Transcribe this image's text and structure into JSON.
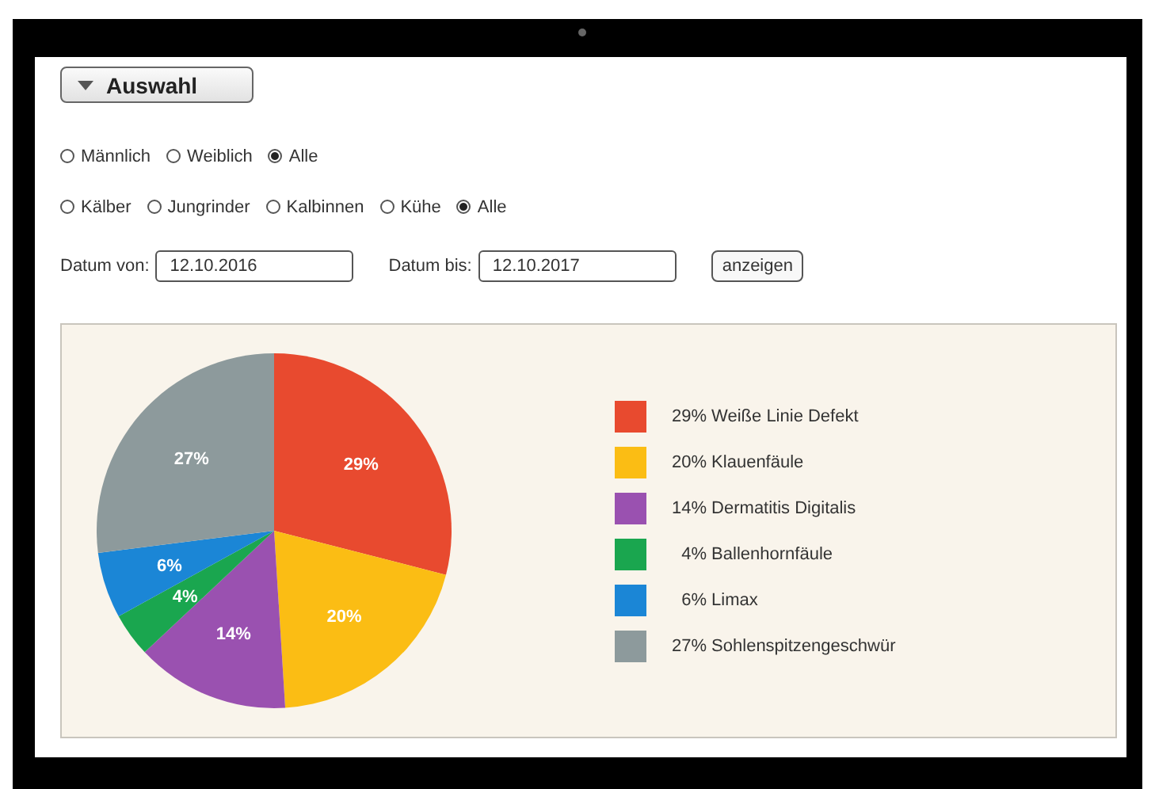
{
  "toggle": {
    "label": "Auswahl",
    "expanded": true
  },
  "sex_options": [
    {
      "label": "Männlich",
      "selected": false
    },
    {
      "label": "Weiblich",
      "selected": false
    },
    {
      "label": "Alle",
      "selected": true
    }
  ],
  "group_options": [
    {
      "label": "Kälber",
      "selected": false
    },
    {
      "label": "Jungrinder",
      "selected": false
    },
    {
      "label": "Kalbinnen",
      "selected": false
    },
    {
      "label": "Kühe",
      "selected": false
    },
    {
      "label": "Alle",
      "selected": true
    }
  ],
  "date_from": {
    "label": "Datum von:",
    "value": "12.10.2016"
  },
  "date_to": {
    "label": "Datum bis:",
    "value": "12.10.2017"
  },
  "show_button": "anzeigen",
  "chart_data": {
    "type": "pie",
    "categories": [
      "Weiße Linie Defekt",
      "Klauenfäule",
      "Dermatitis Digitalis",
      "Ballenhornfäule",
      "Limax",
      "Sohlenspitzengeschwür"
    ],
    "values": [
      29,
      20,
      14,
      4,
      6,
      27
    ],
    "data_labels": true,
    "value_labels": [
      "29%",
      "20%",
      "14%",
      "4%",
      "6%",
      "27%"
    ]
  },
  "legend": [
    {
      "color": "#e84a2f"
    },
    {
      "color": "#fbbd14"
    },
    {
      "color": "#9a51b0"
    },
    {
      "color": "#1aa64f"
    },
    {
      "color": "#1b86d6"
    },
    {
      "color": "#8d9a9c"
    }
  ]
}
